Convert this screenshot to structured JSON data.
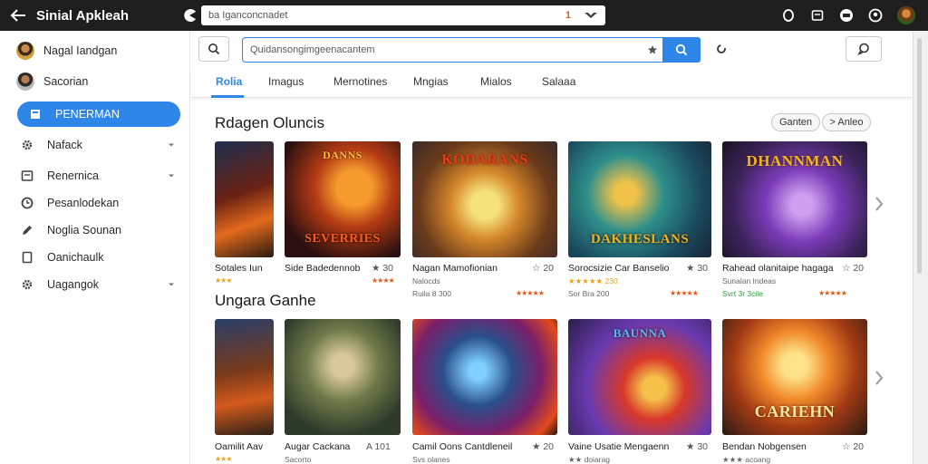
{
  "topbar": {
    "title": "Sinial Apkleah",
    "url": "ba Iganconcnadet",
    "url_badge": "1"
  },
  "sidebar": {
    "items": [
      {
        "label": "Nagal Iandgan",
        "icon": "avatar-icon"
      },
      {
        "label": "Sacorian",
        "icon": "avatar-icon"
      },
      {
        "label": "PENERMAN",
        "icon": "tablet-icon",
        "active": true
      },
      {
        "label": "Nafack",
        "icon": "gear-icon",
        "expandable": true
      },
      {
        "label": "Renernica",
        "icon": "window-icon",
        "expandable": true
      },
      {
        "label": "Pesanlodekan",
        "icon": "clock-icon"
      },
      {
        "label": "Noglia Sounan",
        "icon": "pencil-icon"
      },
      {
        "label": "Oanichaulk",
        "icon": "document-icon"
      },
      {
        "label": "Uagangok",
        "icon": "gear-icon",
        "expandable": true
      }
    ]
  },
  "search": {
    "placeholder": "Quidansongimgeenacantem"
  },
  "tabs": [
    "Rolia",
    "Imagus",
    "Mernotines",
    "Mngias",
    "Mialos",
    "Salaaa"
  ],
  "sections": [
    {
      "title": "Rdagen Oluncis",
      "pills": [
        "Ganten",
        "> Anleo"
      ],
      "cards": [
        {
          "name": "Sotales Iun",
          "rating": "",
          "sub": "",
          "stars": "★★★",
          "logo": ""
        },
        {
          "name": "Side Badedennob",
          "rating": "★ 30",
          "sub": "",
          "stars": "★★★★",
          "logo": "SEVERRIES",
          "logo_top": "DANNS"
        },
        {
          "name": "Nagan Mamofionian",
          "rating": "☆ 20",
          "sub": "Ruila 8 300",
          "sub_top": "Nalocds",
          "stars": "★★★★★",
          "logo": "KODARANS"
        },
        {
          "name": "Sorocsizie Car Banselio",
          "rating": "★ 30",
          "sub": "Sor Bra 200",
          "sub_top": "★★★★★ 230",
          "stars": "★★★★★",
          "logo": "DAKHESLANS"
        },
        {
          "name": "Rahead olanitaipe hagaga",
          "rating": "☆ 20",
          "sub": "Svrt 3r 3cile",
          "sub_top": "Sunalan Indeas",
          "stars": "★★★★★",
          "logo": "DHANNMAN"
        }
      ]
    },
    {
      "title": "Ungara Ganhe",
      "cards": [
        {
          "name": "Oamilit Aav",
          "rating": "",
          "sub": "",
          "stars": "★★★",
          "logo": ""
        },
        {
          "name": "Augar Cackana",
          "rating": "A 101",
          "sub": "Sacorto",
          "stars": "",
          "logo": ""
        },
        {
          "name": "Camil Oons Cantdleneil",
          "rating": "★ 20",
          "sub": "Svs olanes",
          "stars": "",
          "logo": ""
        },
        {
          "name": "Vaine Usatie Mengaenn",
          "rating": "★ 30",
          "sub": "★★ doiarag",
          "stars": "",
          "logo": "BAUNNA"
        },
        {
          "name": "Bendan Nobgensen",
          "rating": "☆ 20",
          "sub": "★★★ acoang",
          "stars": "",
          "logo": "CARIEHN"
        }
      ]
    }
  ]
}
